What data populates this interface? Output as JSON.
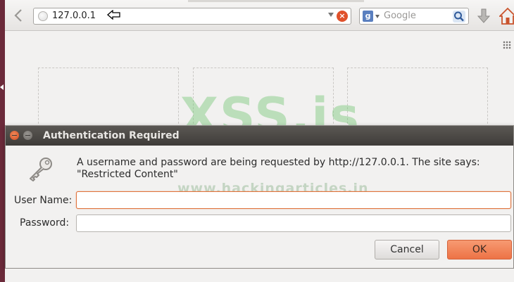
{
  "browser": {
    "url": "127.0.0.1",
    "search_placeholder": "Google",
    "search_engine_icon": "g",
    "stop_icon": "×"
  },
  "watermarks": {
    "main": "XSS.is",
    "url": "www.hackingarticles.in"
  },
  "dialog": {
    "title": "Authentication Required",
    "message": "A username and password are being requested by http://127.0.0.1. The site says: \"Restricted Content\"",
    "username_label": "User Name:",
    "password_label": "Password:",
    "username_value": "",
    "password_value": "",
    "cancel_label": "Cancel",
    "ok_label": "OK"
  },
  "colors": {
    "accent": "#ed7346",
    "titlebar": "#3f3c39",
    "sidebar_edge": "#6b2a3a"
  }
}
